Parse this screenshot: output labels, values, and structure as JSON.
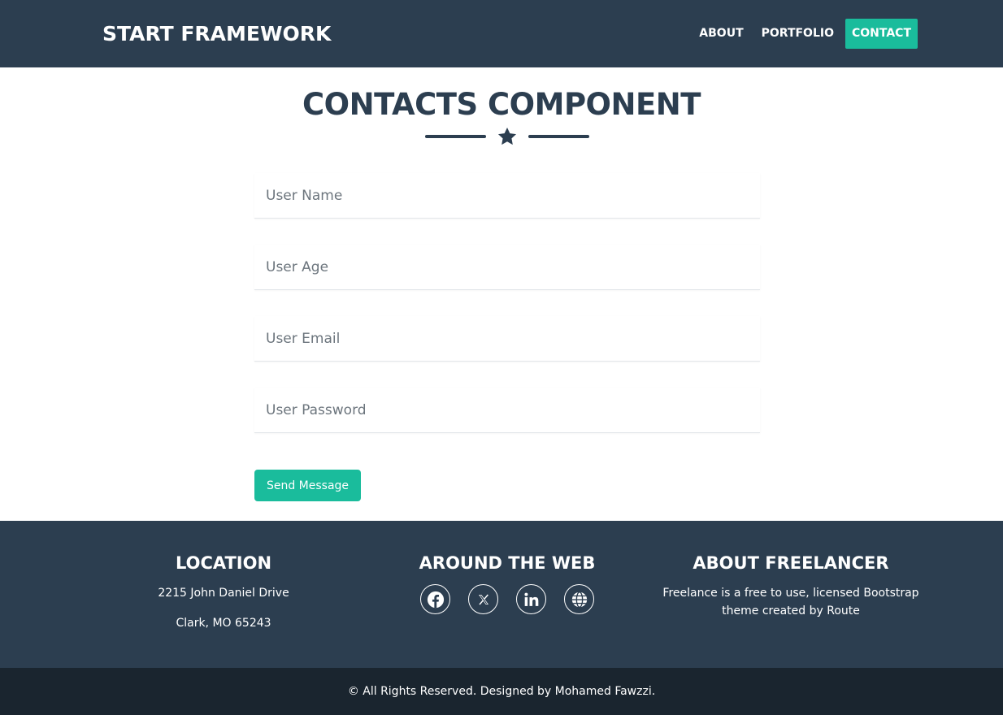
{
  "navbar": {
    "brand": "START FRAMEWORK",
    "links": [
      {
        "label": "ABOUT",
        "active": false
      },
      {
        "label": "PORTFOLIO",
        "active": false
      },
      {
        "label": "CONTACT",
        "active": true
      }
    ]
  },
  "main": {
    "title": "CONTACTS COMPONENT",
    "divider_icon": "star-icon",
    "form": {
      "fields": [
        {
          "placeholder": "User Name",
          "value": ""
        },
        {
          "placeholder": "User Age",
          "value": ""
        },
        {
          "placeholder": "User Email",
          "value": ""
        },
        {
          "placeholder": "User Password",
          "value": ""
        }
      ],
      "submit_label": "Send Message"
    }
  },
  "footer": {
    "location": {
      "heading": "LOCATION",
      "line1": "2215 John Daniel Drive",
      "line2": "Clark, MO 65243"
    },
    "web": {
      "heading": "AROUND THE WEB",
      "icons": [
        "facebook-icon",
        "x-icon",
        "linkedin-icon",
        "globe-icon"
      ]
    },
    "about": {
      "heading": "ABOUT FREELANCER",
      "text": "Freelance is a free to use, licensed Bootstrap theme created by Route"
    }
  },
  "copyright": "© All Rights Reserved. Designed by Mohamed Fawzzi.",
  "colors": {
    "primary_dark": "#2c3e50",
    "accent": "#1abc9c",
    "copyright_bg": "#1a252f"
  }
}
